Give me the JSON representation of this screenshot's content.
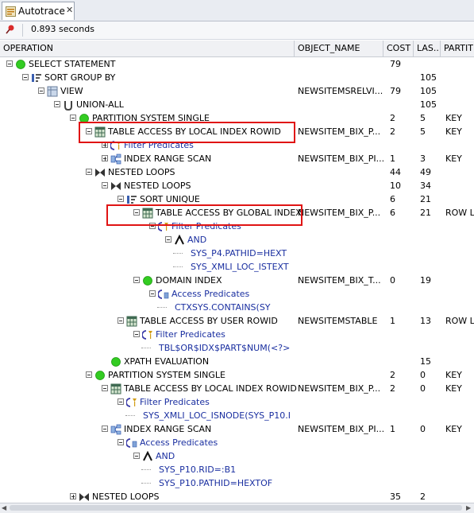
{
  "tab": {
    "label": "Autotrace",
    "close": "✕"
  },
  "toolbar": {
    "elapsed": "0.893 seconds"
  },
  "columns": [
    "OPERATION",
    "OBJECT_NAME",
    "COST",
    "LAS...",
    "PARTIT"
  ],
  "rows": [
    {
      "op": "SELECT STATEMENT",
      "obj": "",
      "cost": "79",
      "last": "",
      "part": ""
    },
    {
      "op": "SORT GROUP BY",
      "obj": "",
      "cost": "",
      "last": "105",
      "part": ""
    },
    {
      "op": "VIEW",
      "obj": "NEWSITEMSRELVI...",
      "cost": "79",
      "last": "105",
      "part": ""
    },
    {
      "op": "UNION-ALL",
      "obj": "",
      "cost": "",
      "last": "105",
      "part": ""
    },
    {
      "op": "PARTITION SYSTEM SINGLE",
      "obj": "",
      "cost": "2",
      "last": "5",
      "part": "KEY"
    },
    {
      "op": "TABLE ACCESS BY LOCAL INDEX ROWID",
      "obj": "NEWSITEM_BIX_P...",
      "cost": "2",
      "last": "5",
      "part": "KEY"
    },
    {
      "op": "Filter Predicates",
      "obj": "",
      "cost": "",
      "last": "",
      "part": ""
    },
    {
      "op": "INDEX RANGE SCAN",
      "obj": "NEWSITEM_BIX_PI...",
      "cost": "1",
      "last": "3",
      "part": "KEY"
    },
    {
      "op": "NESTED LOOPS",
      "obj": "",
      "cost": "44",
      "last": "49",
      "part": ""
    },
    {
      "op": "NESTED LOOPS",
      "obj": "",
      "cost": "10",
      "last": "34",
      "part": ""
    },
    {
      "op": "SORT UNIQUE",
      "obj": "",
      "cost": "6",
      "last": "21",
      "part": ""
    },
    {
      "op": "TABLE ACCESS BY GLOBAL INDEX",
      "obj": "NEWSITEM_BIX_P...",
      "cost": "6",
      "last": "21",
      "part": "ROW L"
    },
    {
      "op": "Filter Predicates",
      "obj": "",
      "cost": "",
      "last": "",
      "part": ""
    },
    {
      "op": "AND",
      "obj": "",
      "cost": "",
      "last": "",
      "part": ""
    },
    {
      "op": "SYS_P4.PATHID=HEXT",
      "obj": "",
      "cost": "",
      "last": "",
      "part": ""
    },
    {
      "op": "SYS_XMLI_LOC_ISTEXT",
      "obj": "",
      "cost": "",
      "last": "",
      "part": ""
    },
    {
      "op": "DOMAIN INDEX",
      "obj": "NEWSITEM_BIX_T...",
      "cost": "0",
      "last": "19",
      "part": ""
    },
    {
      "op": "Access Predicates",
      "obj": "",
      "cost": "",
      "last": "",
      "part": ""
    },
    {
      "op": "CTXSYS.CONTAINS(SY",
      "obj": "",
      "cost": "",
      "last": "",
      "part": ""
    },
    {
      "op": "TABLE ACCESS BY USER ROWID",
      "obj": "NEWSITEMSTABLE",
      "cost": "1",
      "last": "13",
      "part": "ROW L"
    },
    {
      "op": "Filter Predicates",
      "obj": "",
      "cost": "",
      "last": "",
      "part": ""
    },
    {
      "op": "TBL$OR$IDX$PART$NUM(<?>",
      "obj": "",
      "cost": "",
      "last": "",
      "part": ""
    },
    {
      "op": "XPATH EVALUATION",
      "obj": "",
      "cost": "",
      "last": "15",
      "part": ""
    },
    {
      "op": "PARTITION SYSTEM SINGLE",
      "obj": "",
      "cost": "2",
      "last": "0",
      "part": "KEY"
    },
    {
      "op": "TABLE ACCESS BY LOCAL INDEX ROWID",
      "obj": "NEWSITEM_BIX_P...",
      "cost": "2",
      "last": "0",
      "part": "KEY"
    },
    {
      "op": "Filter Predicates",
      "obj": "",
      "cost": "",
      "last": "",
      "part": ""
    },
    {
      "op": "SYS_XMLI_LOC_ISNODE(SYS_P10.I",
      "obj": "",
      "cost": "",
      "last": "",
      "part": ""
    },
    {
      "op": "INDEX RANGE SCAN",
      "obj": "NEWSITEM_BIX_PI...",
      "cost": "1",
      "last": "0",
      "part": "KEY"
    },
    {
      "op": "Access Predicates",
      "obj": "",
      "cost": "",
      "last": "",
      "part": ""
    },
    {
      "op": "AND",
      "obj": "",
      "cost": "",
      "last": "",
      "part": ""
    },
    {
      "op": "SYS_P10.RID=:B1",
      "obj": "",
      "cost": "",
      "last": "",
      "part": ""
    },
    {
      "op": "SYS_P10.PATHID=HEXTOF",
      "obj": "",
      "cost": "",
      "last": "",
      "part": ""
    },
    {
      "op": "NESTED LOOPS",
      "obj": "",
      "cost": "35",
      "last": "2",
      "part": ""
    }
  ],
  "colors": {
    "highlight": "#e01414",
    "predicate_text": "#1a2fa0",
    "status_green": "#33cc22"
  }
}
